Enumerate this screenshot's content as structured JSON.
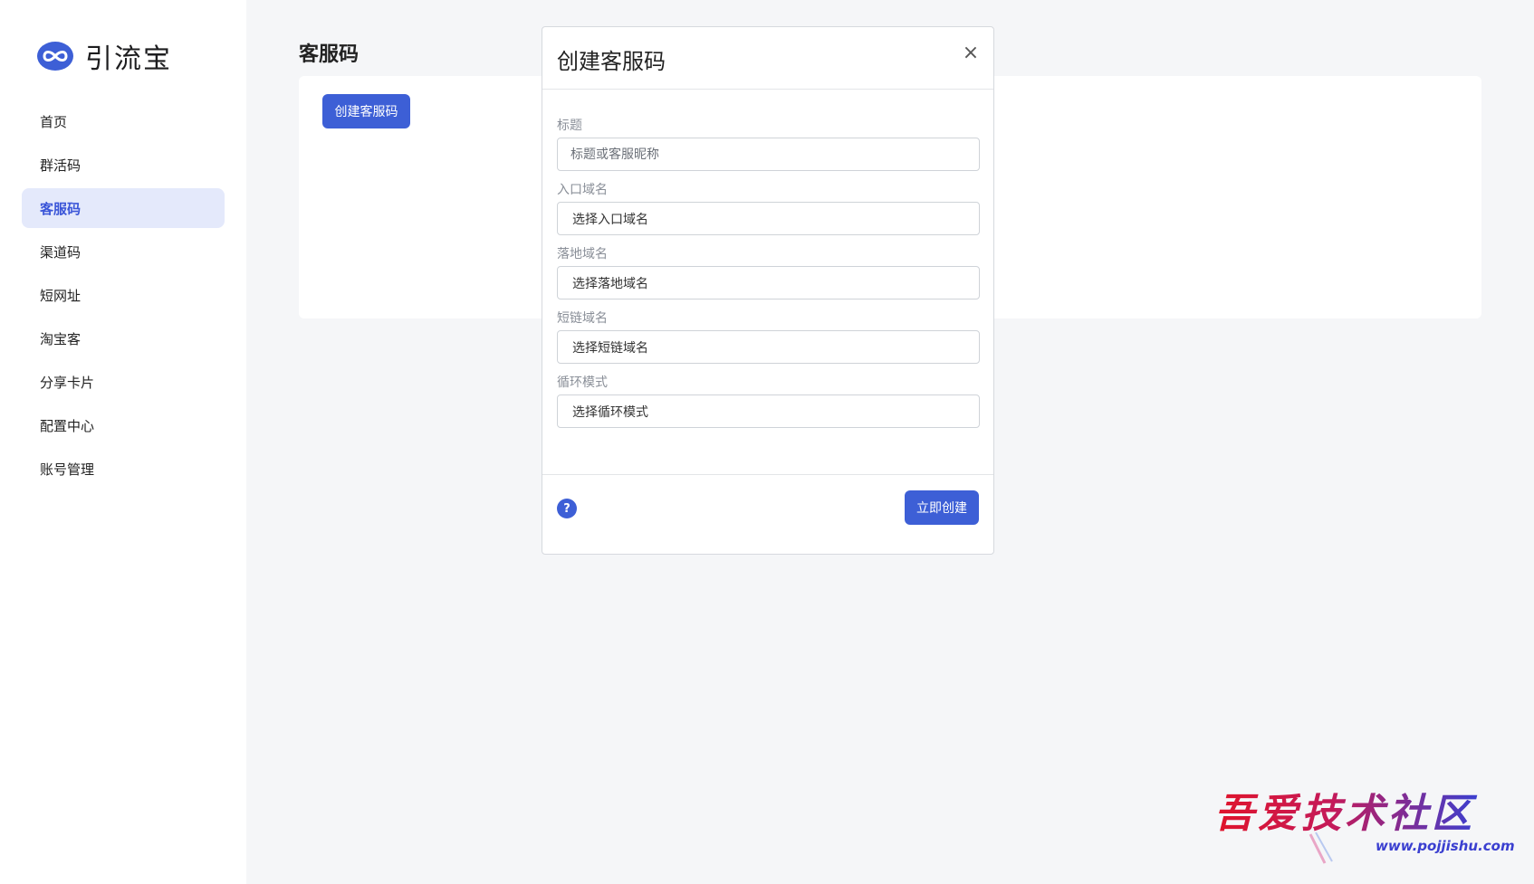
{
  "brand": {
    "name": "引流宝",
    "logo_icon": "infinity-logo-icon",
    "accent": "#3d5fd6"
  },
  "sidebar": {
    "items": [
      {
        "label": "首页",
        "active": false
      },
      {
        "label": "群活码",
        "active": false
      },
      {
        "label": "客服码",
        "active": true
      },
      {
        "label": "渠道码",
        "active": false
      },
      {
        "label": "短网址",
        "active": false
      },
      {
        "label": "淘宝客",
        "active": false
      },
      {
        "label": "分享卡片",
        "active": false
      },
      {
        "label": "配置中心",
        "active": false
      },
      {
        "label": "账号管理",
        "active": false
      }
    ]
  },
  "main": {
    "title": "客服码",
    "create_button": "创建客服码"
  },
  "modal": {
    "title": "创建客服码",
    "close_icon": "close-icon",
    "fields": {
      "title": {
        "label": "标题",
        "placeholder": "标题或客服昵称"
      },
      "entry_domain": {
        "label": "入口域名",
        "value": "选择入口域名"
      },
      "landing_domain": {
        "label": "落地域名",
        "value": "选择落地域名"
      },
      "short_domain": {
        "label": "短链域名",
        "value": "选择短链域名"
      },
      "loop_mode": {
        "label": "循环模式",
        "value": "选择循环模式"
      }
    },
    "help_icon": "question-icon",
    "submit_button": "立即创建"
  },
  "watermark": {
    "text": "吾爱技术社区",
    "url": "www.pojjishu.com"
  }
}
